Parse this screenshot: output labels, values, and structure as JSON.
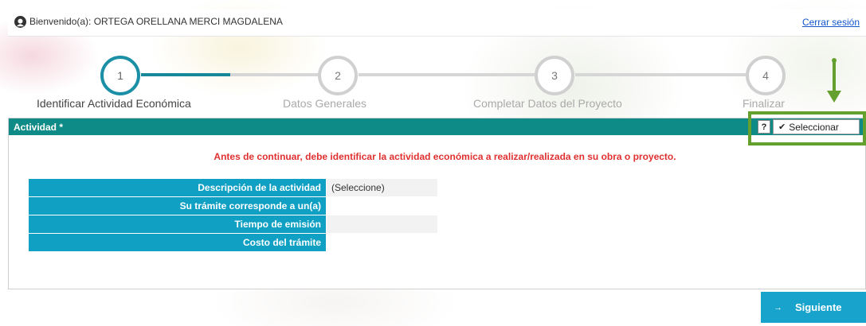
{
  "header": {
    "welcome_text": "Bienvenido(a): ORTEGA ORELLANA MERCI MAGDALENA",
    "logout_label": "Cerrar sesión"
  },
  "stepper": {
    "steps": [
      {
        "number": "1",
        "label": "Identificar Actividad Económica",
        "active": true
      },
      {
        "number": "2",
        "label": "Datos Generales",
        "active": false
      },
      {
        "number": "3",
        "label": "Completar Datos del Proyecto",
        "active": false
      },
      {
        "number": "4",
        "label": "Finalizar",
        "active": false
      }
    ]
  },
  "panel": {
    "title": "Actividad *",
    "help_label": "?",
    "select_label": "Seleccionar",
    "warning": "Antes de continuar, debe identificar la actividad económica a realizar/realizada en su obra o proyecto.",
    "rows": [
      {
        "label": "Descripción de la actividad",
        "value": "(Seleccione)"
      },
      {
        "label": "Su trámite corresponde a un(a)",
        "value": ""
      },
      {
        "label": "Tiempo de emisión",
        "value": ""
      },
      {
        "label": "Costo del trámite",
        "value": ""
      }
    ]
  },
  "footer": {
    "next_label": "Siguiente"
  },
  "colors": {
    "header_teal": "#0e8a87",
    "table_header_blue": "#0fa0c4",
    "step_active": "#1a8fa6",
    "warning_red": "#e03030",
    "highlight_green": "#64a02e",
    "next_button": "#17a3cc"
  }
}
